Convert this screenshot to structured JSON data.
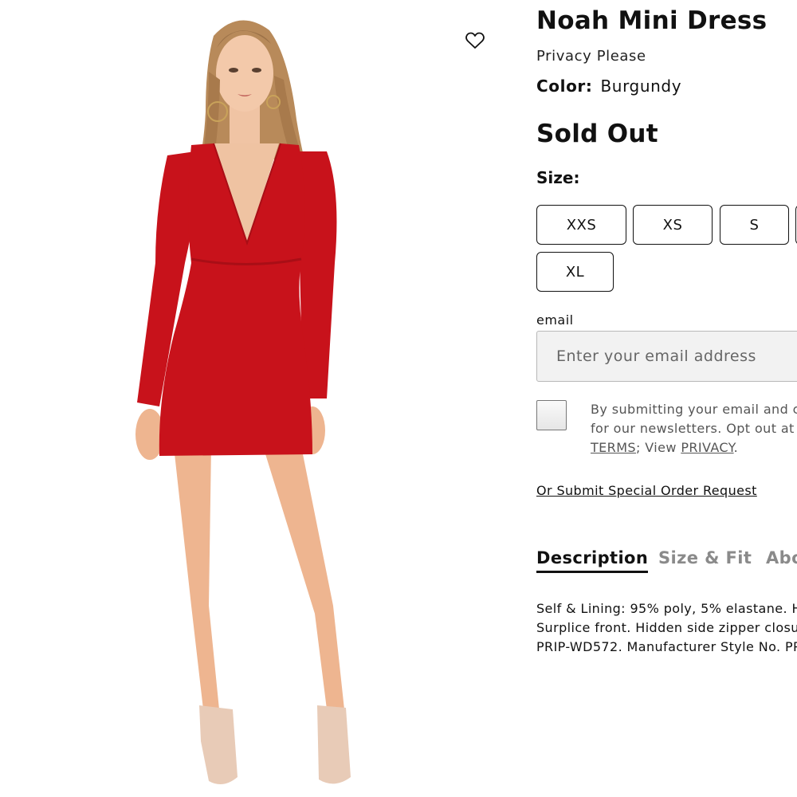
{
  "product": {
    "title": "Noah Mini Dress",
    "brand": "Privacy Please",
    "color_label": "Color:",
    "color_value": "Burgundy",
    "stock_status": "Sold Out",
    "size_label": "Size:",
    "sizes": [
      "XXS",
      "XS",
      "S",
      "XL"
    ]
  },
  "image": {
    "alt": "Model wearing red long-sleeve plunging mini dress",
    "dress_color": "#c8121b"
  },
  "wishlist": {
    "icon": "heart-icon"
  },
  "newsletter": {
    "email_label": "email",
    "email_placeholder": "Enter your email address",
    "consent_line1": "By submitting your email and c",
    "consent_line2": "for our newsletters. Opt out at",
    "terms_link": "TERMS",
    "consent_mid": "; View ",
    "privacy_link": "PRIVACY",
    "consent_end": "."
  },
  "special_order_link": "Or Submit Special Order Request",
  "tabs": [
    {
      "label": "Description",
      "active": true
    },
    {
      "label": "Size & Fit",
      "active": false
    },
    {
      "label": "Abo",
      "active": false
    }
  ],
  "description": {
    "line1": "Self & Lining: 95% poly, 5% elastane. H",
    "line2": "Surplice front. Hidden side zipper closu",
    "line3": "PRIP-WD572. Manufacturer Style No. PP"
  }
}
